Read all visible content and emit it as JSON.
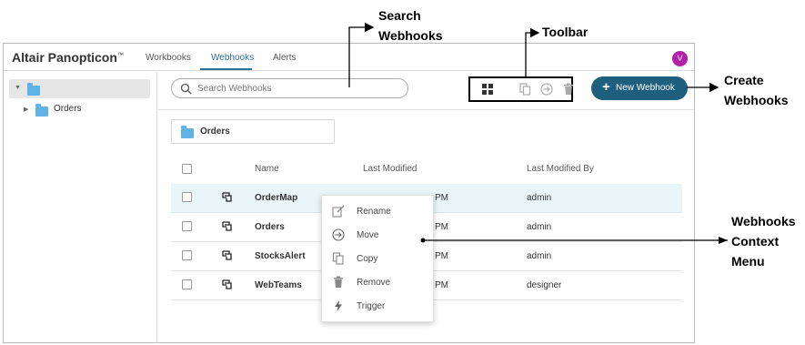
{
  "app": {
    "brand": "Altair Panopticon",
    "brand_mark": "™",
    "tabs": [
      {
        "label": "Workbooks",
        "active": false
      },
      {
        "label": "Webhooks",
        "active": true
      },
      {
        "label": "Alerts",
        "active": false
      }
    ],
    "avatar_initial": "V"
  },
  "sidebar": {
    "root_label": "",
    "items": [
      {
        "label": "Orders"
      }
    ]
  },
  "search": {
    "placeholder": "Search Webhooks"
  },
  "toolbar": {
    "icons": [
      "grid-view-icon",
      "copy-icon",
      "move-icon",
      "trash-icon"
    ],
    "new_button": "New Webhook"
  },
  "folder_card": {
    "label": "Orders"
  },
  "table": {
    "columns": [
      "Name",
      "Last Modified",
      "Last Modified By"
    ],
    "rows": [
      {
        "name": "OrderMap",
        "modified": "PM",
        "modified_by": "admin",
        "selected": true
      },
      {
        "name": "Orders",
        "modified": "PM",
        "modified_by": "admin",
        "selected": false
      },
      {
        "name": "StocksAlert",
        "modified": "PM",
        "modified_by": "admin",
        "selected": false
      },
      {
        "name": "WebTeams",
        "modified": "PM",
        "modified_by": "designer",
        "selected": false
      }
    ]
  },
  "context_menu": {
    "items": [
      {
        "label": "Rename",
        "icon": "rename-icon"
      },
      {
        "label": "Move",
        "icon": "move-icon"
      },
      {
        "label": "Copy",
        "icon": "copy-icon"
      },
      {
        "label": "Remove",
        "icon": "trash-icon"
      },
      {
        "label": "Trigger",
        "icon": "lightning-icon"
      }
    ]
  },
  "callouts": {
    "search_line1": "Search",
    "search_line2": "Webhooks",
    "toolbar": "Toolbar",
    "create_line1": "Create",
    "create_line2": "Webhooks",
    "menu_line1": "Webhooks",
    "menu_line2": "Context",
    "menu_line3": "Menu"
  },
  "colors": {
    "accent": "#2a6f97",
    "button": "#1f5f7e",
    "avatar": "#b21fa8",
    "folder": "#5fb2e5",
    "selected_row": "#e9f5f8"
  }
}
